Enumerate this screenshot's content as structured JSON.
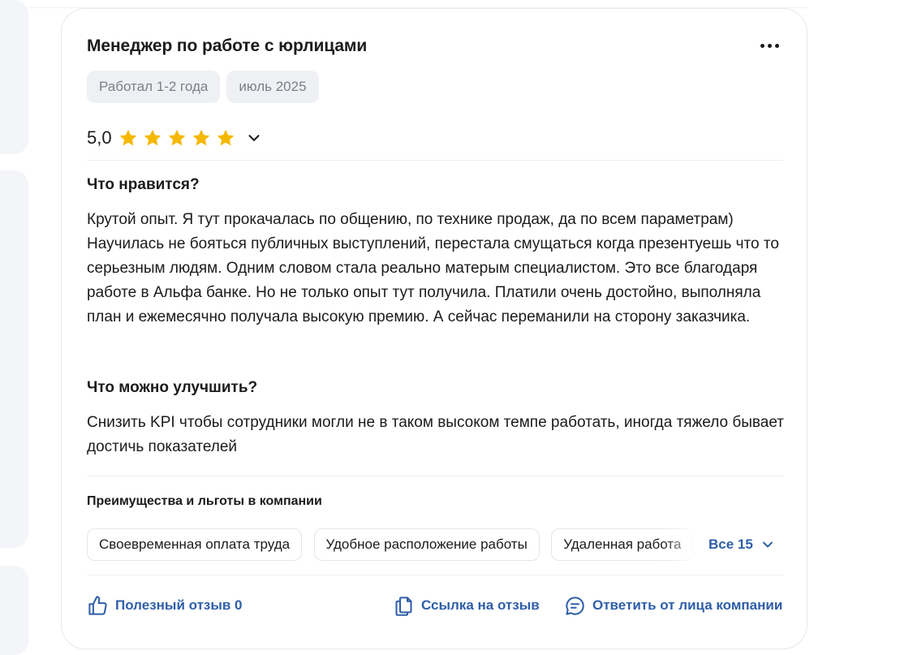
{
  "review": {
    "title": "Менеджер по работе с юрлицами",
    "tags": [
      "Работал 1-2 года",
      "июль 2025"
    ],
    "rating": "5,0",
    "stars": 5,
    "likes_heading": "Что нравится?",
    "likes_text": "Крутой опыт. Я тут прокачалась по общению, по технике продаж, да по всем параметрам) Научилась не бояться публичных выступлений, перестала смущаться когда презентуешь что то серьезным людям. Одним словом стала реально матерым специалистом. Это все благодаря работе в Альфа банке. Но не только опыт тут получила. Платили очень достойно, выполняла план и ежемесячно получала высокую премию. А сейчас переманили на сторону заказчика.",
    "improve_heading": "Что можно улучшить?",
    "improve_text": "Снизить KPI чтобы сотрудники могли не в таком высоком темпе работать, иногда тяжело бывает достичь показателей"
  },
  "perks": {
    "heading": "Преимущества и льготы в компании",
    "items": [
      "Своевременная оплата труда",
      "Удобное расположение работы",
      "Удаленная работа"
    ],
    "show_all_label": "Все 15"
  },
  "actions": {
    "helpful_label": "Полезный отзыв 0",
    "link_label": "Ссылка на отзыв",
    "reply_label": "Ответить от лица компании"
  },
  "colors": {
    "accent": "#2f5ea8",
    "star": "#f5b800",
    "tag_bg": "#eef0f3"
  },
  "icons": {
    "menu": "more-horizontal-icon",
    "rating_toggle": "chevron-down-icon",
    "helpful": "thumbs-up-icon",
    "link": "copy-icon",
    "reply": "message-icon"
  }
}
